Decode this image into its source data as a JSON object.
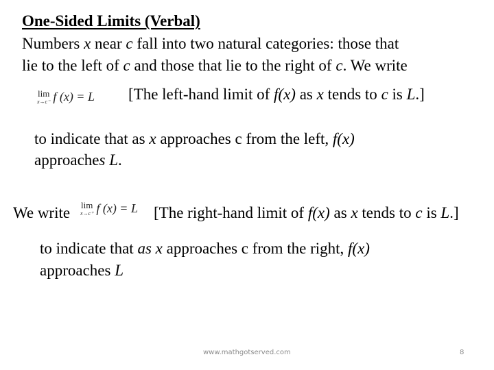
{
  "slide": {
    "title": "One-Sided Limits (Verbal)",
    "intro": {
      "line1": {
        "a": "Numbers ",
        "x": "x",
        "b": " near ",
        "c": "c",
        "d": " fall into two natural categories: those that"
      },
      "line2": {
        "a": "lie to the left of ",
        "c1": "c",
        "b": " and those that lie to the right of ",
        "c2": "c",
        "d": ". We write"
      }
    },
    "left_limit": {
      "formula": {
        "lim": "lim",
        "sub": "x→c⁻",
        "expr": "f (x) = L"
      },
      "bracket": {
        "a": "[The left-hand limit of ",
        "fx": "f(x)",
        "b": " as ",
        "x": "x",
        "c": " tends to ",
        "cvar": "c",
        "d": " is ",
        "L": "L",
        "e": ".]"
      },
      "explain_line1": {
        "a": "to indicate that as ",
        "x": "x",
        "b": " approaches c from the left, ",
        "fx": "f(x)"
      },
      "explain_line2": {
        "a": "approache",
        "s": "s L",
        "b": "."
      }
    },
    "right_limit": {
      "prefix": "We write",
      "formula": {
        "lim": "lim",
        "sub": "x→c⁺",
        "expr": "f (x) = L"
      },
      "bracket": {
        "a": "[The right-hand limit of ",
        "fx": "f(x)",
        "b": " as ",
        "x": "x",
        "c": " tends to ",
        "cvar": "c",
        "d": " is ",
        "L": "L",
        "e": ".]"
      },
      "explain_line1": {
        "a": "to indicate that ",
        "asx": "as x",
        "b": " approaches c from the right, ",
        "fx": "f(x)"
      },
      "explain_line2": {
        "a": "approaches ",
        "L": "L"
      }
    }
  },
  "footer": {
    "url": "www.mathgotserved.com",
    "page_number": "8"
  }
}
